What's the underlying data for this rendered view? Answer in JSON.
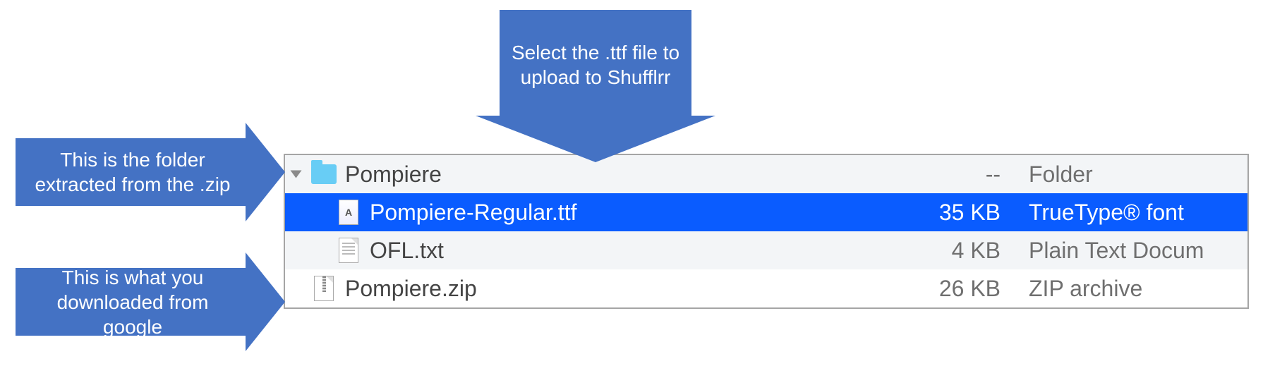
{
  "callouts": {
    "top_select_ttf": "Select the .ttf file to upload to Shufflrr",
    "left_extracted_folder": "This is the folder extracted from the .zip",
    "left_downloaded_zip": "This is what you downloaded from google"
  },
  "files": [
    {
      "name": "Pompiere",
      "size": "--",
      "kind": "Folder",
      "icon": "folder",
      "indent": 0,
      "alt": true,
      "selected": false,
      "disclosure": true
    },
    {
      "name": "Pompiere-Regular.ttf",
      "size": "35 KB",
      "kind": "TrueType® font",
      "icon": "ttf",
      "indent": 1,
      "alt": false,
      "selected": true,
      "disclosure": false
    },
    {
      "name": "OFL.txt",
      "size": "4 KB",
      "kind": "Plain Text Docum",
      "icon": "txt",
      "indent": 1,
      "alt": true,
      "selected": false,
      "disclosure": false
    },
    {
      "name": "Pompiere.zip",
      "size": "26 KB",
      "kind": "ZIP archive",
      "icon": "zip",
      "indent": 0,
      "alt": false,
      "selected": false,
      "disclosure": false
    }
  ]
}
